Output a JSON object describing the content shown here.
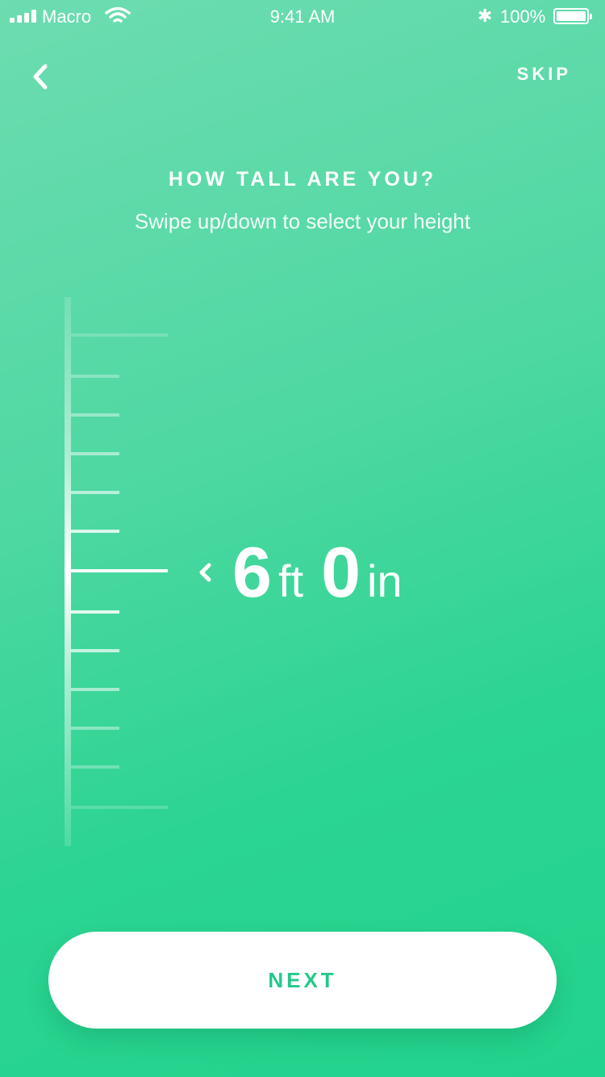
{
  "status_bar": {
    "carrier": "Macro",
    "time": "9:41 AM",
    "battery": "100%"
  },
  "nav": {
    "back_icon": "chevron-left-icon",
    "skip_label": "SKIP"
  },
  "header": {
    "title": "HOW TALL ARE YOU?",
    "subtitle": "Swipe up/down to select your height"
  },
  "height": {
    "feet": "6",
    "feet_unit": "ft",
    "inches": "0",
    "inches_unit": "in"
  },
  "next_label": "NEXT",
  "colors": {
    "accent": "#22c98a",
    "bg_top": "#6ddcb0",
    "bg_bottom": "#22d38d"
  }
}
